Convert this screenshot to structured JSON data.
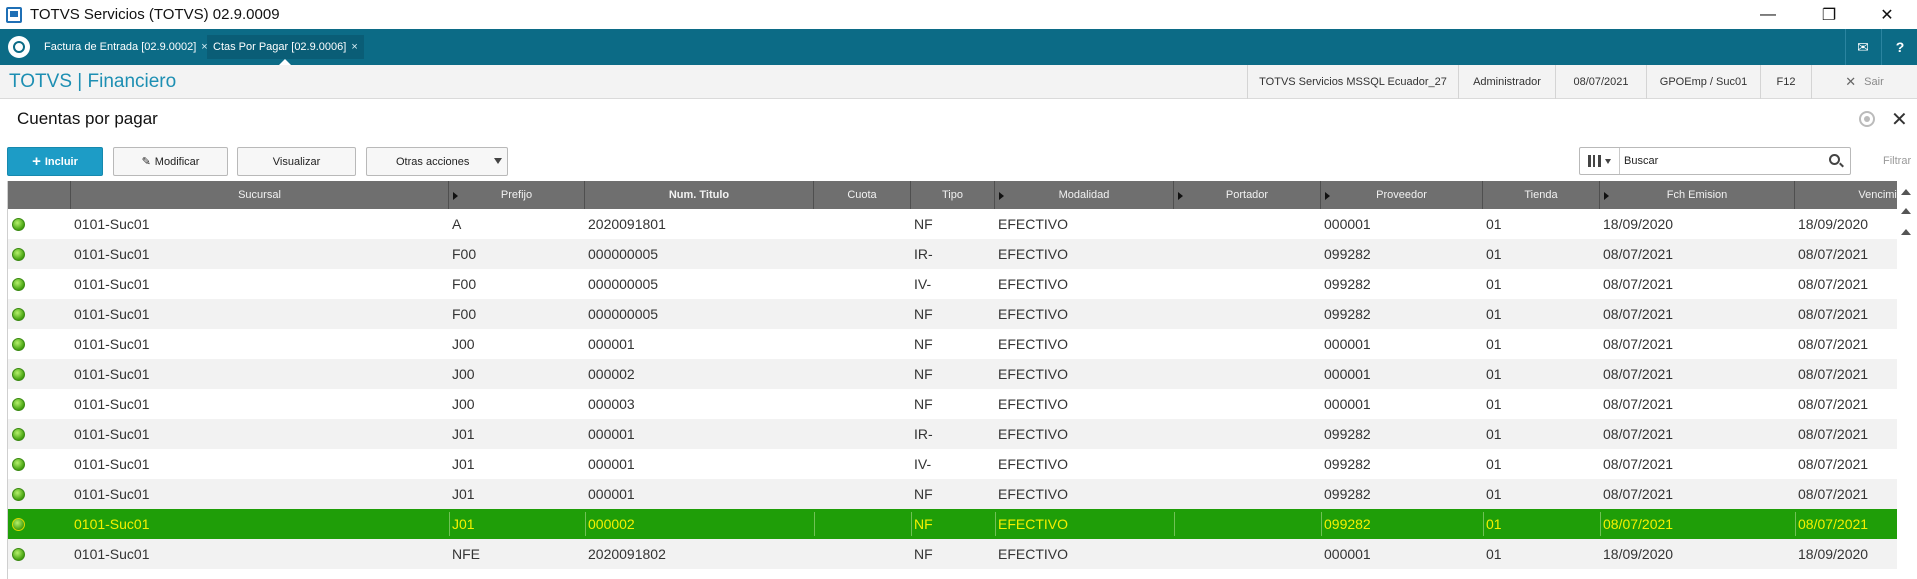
{
  "window": {
    "title": "TOTVS Servicios (TOTVS) 02.9.0009",
    "minimize": "—",
    "maximize": "❐",
    "close": "✕"
  },
  "tabs": [
    {
      "label": "Factura de Entrada [02.9.0002]",
      "close": "×",
      "active": false
    },
    {
      "label": "Ctas Por Pagar [02.9.0006]",
      "close": "×",
      "active": true
    }
  ],
  "tab_icons": {
    "mail": "✉",
    "help": "?"
  },
  "header": {
    "brand": "TOTVS | Financiero",
    "company": "TOTVS Servicios MSSQL Ecuador_27",
    "user": "Administrador",
    "date": "08/07/2021",
    "branch": "GPOEmp / Suc01",
    "shortcut": "F12",
    "exit_label": "Sair",
    "exit_icon": "✕"
  },
  "page": {
    "title": "Cuentas por pagar",
    "close_icon": "✕"
  },
  "toolbar": {
    "include_icon": "+",
    "include_label": "Incluir",
    "modify_icon": "✎",
    "modify_label": "Modificar",
    "view_label": "Visualizar",
    "other_label": "Otras acciones",
    "search_placeholder": "Buscar",
    "filter_label": "Filtrar"
  },
  "grid": {
    "columns": [
      "Sucursal",
      "Prefijo",
      "Num. Titulo",
      "Cuota",
      "Tipo",
      "Modalidad",
      "Portador",
      "Proveedor",
      "Tienda",
      "Fch Emision",
      "Vencimie"
    ],
    "rows": [
      {
        "status": "green",
        "cells": [
          "0101-Suc01",
          "A",
          "2020091801",
          "",
          "NF",
          "EFECTIVO",
          "",
          "000001",
          "01",
          "18/09/2020",
          "18/09/2020"
        ]
      },
      {
        "status": "green",
        "cells": [
          "0101-Suc01",
          "F00",
          "000000005",
          "",
          "IR-",
          "EFECTIVO",
          "",
          "099282",
          "01",
          "08/07/2021",
          "08/07/2021"
        ]
      },
      {
        "status": "green",
        "cells": [
          "0101-Suc01",
          "F00",
          "000000005",
          "",
          "IV-",
          "EFECTIVO",
          "",
          "099282",
          "01",
          "08/07/2021",
          "08/07/2021"
        ]
      },
      {
        "status": "green",
        "cells": [
          "0101-Suc01",
          "F00",
          "000000005",
          "",
          "NF",
          "EFECTIVO",
          "",
          "099282",
          "01",
          "08/07/2021",
          "08/07/2021"
        ]
      },
      {
        "status": "green",
        "cells": [
          "0101-Suc01",
          "J00",
          "000001",
          "",
          "NF",
          "EFECTIVO",
          "",
          "000001",
          "01",
          "08/07/2021",
          "08/07/2021"
        ]
      },
      {
        "status": "green",
        "cells": [
          "0101-Suc01",
          "J00",
          "000002",
          "",
          "NF",
          "EFECTIVO",
          "",
          "000001",
          "01",
          "08/07/2021",
          "08/07/2021"
        ]
      },
      {
        "status": "green",
        "cells": [
          "0101-Suc01",
          "J00",
          "000003",
          "",
          "NF",
          "EFECTIVO",
          "",
          "000001",
          "01",
          "08/07/2021",
          "08/07/2021"
        ]
      },
      {
        "status": "green",
        "cells": [
          "0101-Suc01",
          "J01",
          "000001",
          "",
          "IR-",
          "EFECTIVO",
          "",
          "099282",
          "01",
          "08/07/2021",
          "08/07/2021"
        ]
      },
      {
        "status": "green",
        "cells": [
          "0101-Suc01",
          "J01",
          "000001",
          "",
          "IV-",
          "EFECTIVO",
          "",
          "099282",
          "01",
          "08/07/2021",
          "08/07/2021"
        ]
      },
      {
        "status": "green",
        "cells": [
          "0101-Suc01",
          "J01",
          "000001",
          "",
          "NF",
          "EFECTIVO",
          "",
          "099282",
          "01",
          "08/07/2021",
          "08/07/2021"
        ]
      },
      {
        "status": "green",
        "selected": true,
        "cells": [
          "0101-Suc01",
          "J01",
          "000002",
          "",
          "NF",
          "EFECTIVO",
          "",
          "099282",
          "01",
          "08/07/2021",
          "08/07/2021"
        ]
      },
      {
        "status": "green",
        "cells": [
          "0101-Suc01",
          "NFE",
          "2020091802",
          "",
          "NF",
          "EFECTIVO",
          "",
          "000001",
          "01",
          "18/09/2020",
          "18/09/2020"
        ]
      }
    ]
  },
  "colors": {
    "tabstrip": "#0c6b86",
    "brand": "#1d8fb3",
    "primary_button": "#1d9cc6",
    "grid_header": "#6f6f6f",
    "selected_row": "#1f9e08",
    "selected_text": "#f5f100",
    "status_green": "#44a10f"
  }
}
